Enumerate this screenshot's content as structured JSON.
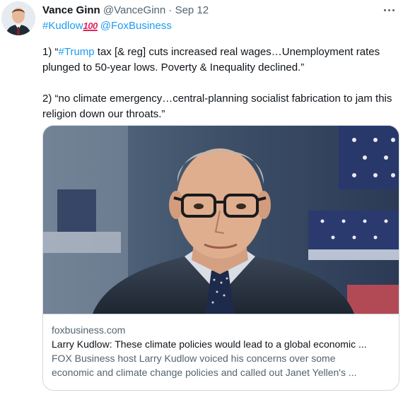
{
  "tweet": {
    "author_name": "Vance Ginn",
    "handle": "@VanceGinn",
    "separator": "·",
    "date": "Sep 12",
    "more_icon": "more-horizontal-icon",
    "hashtag_kudlow": "#Kudlow",
    "emoji_100": "100",
    "mention": "@FoxBusiness",
    "para1_prefix": "1) “",
    "para1_hashtag": "#Trump",
    "para1_line1_rest": " tax [& reg] cuts increased real wages…Unemployment rates",
    "para1_line2": "plunged to 50-year lows. Poverty & Inequality declined.”",
    "para2_line1": "2) “no climate emergency…central-planning socialist fabrication to jam this",
    "para2_line2": "religion down our throats.”"
  },
  "card": {
    "domain": "foxbusiness.com",
    "title": "Larry Kudlow: These climate policies would lead to a global economic ...",
    "description_line1": "FOX Business host Larry Kudlow voiced his concerns over some",
    "description_line2": "economic and climate change policies and called out Janet Yellen's ..."
  },
  "colors": {
    "link": "#1d9bf0",
    "text": "#0f1419",
    "secondary": "#536471",
    "border": "#cfd9de"
  }
}
